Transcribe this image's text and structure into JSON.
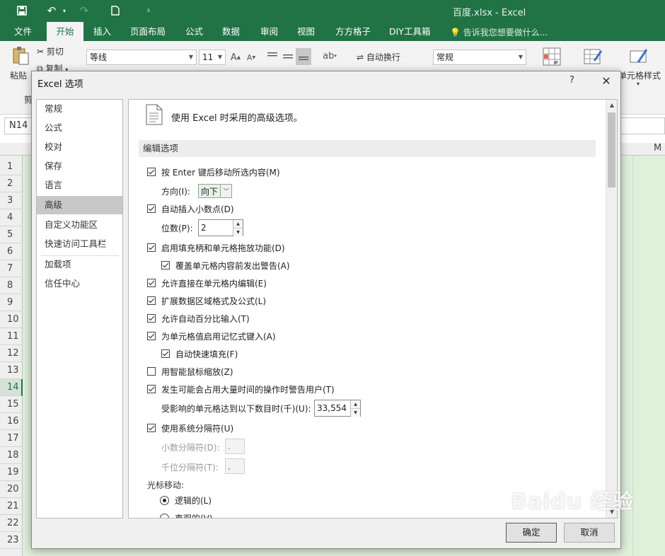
{
  "window": {
    "title": "百度.xlsx - Excel"
  },
  "ribbon_tabs": [
    "文件",
    "开始",
    "插入",
    "页面布局",
    "公式",
    "数据",
    "审阅",
    "视图",
    "方方格子",
    "DIY工具箱"
  ],
  "tell_me": "告诉我您想要做什么...",
  "ribbon": {
    "paste": "粘贴",
    "cut": "剪切",
    "copy": "复制",
    "clipboard_cut": "剪",
    "font_name": "等线",
    "font_size": "11",
    "wrap_text": "自动换行",
    "number_format": "常规",
    "cell_style": "单元格样式"
  },
  "name_box": "N14",
  "sheet": {
    "col_visible": "M",
    "rows": [
      "1",
      "2",
      "3",
      "4",
      "5",
      "6",
      "7",
      "8",
      "9",
      "10",
      "11",
      "12",
      "13",
      "14",
      "15",
      "16",
      "17",
      "18",
      "19",
      "20",
      "21",
      "22",
      "23"
    ],
    "selected_row": "14"
  },
  "dialog": {
    "title": "Excel 选项",
    "help": "?",
    "nav": [
      "常规",
      "公式",
      "校对",
      "保存",
      "语言",
      "高级",
      "自定义功能区",
      "快速访问工具栏",
      "加载项",
      "信任中心"
    ],
    "active_nav": "高级",
    "header": "使用 Excel 时采用的高级选项。",
    "section": "编辑选项",
    "options": {
      "move_after_enter": "按 Enter 键后移动所选内容(M)",
      "direction_label": "方向(I):",
      "direction_value": "向下",
      "auto_decimal": "自动插入小数点(D)",
      "places_label": "位数(P):",
      "places_value": "2",
      "fill_handle": "启用填充柄和单元格拖放功能(D)",
      "alert_overwrite": "覆盖单元格内容前发出警告(A)",
      "edit_in_cell": "允许直接在单元格内编辑(E)",
      "extend_formats": "扩展数据区域格式及公式(L)",
      "auto_percent": "允许自动百分比输入(T)",
      "autocomplete": "为单元格值启用记忆式键入(A)",
      "flash_fill": "自动快速填充(F)",
      "intellimouse": "用智能鼠标缩放(Z)",
      "alert_slow": "发生可能会占用大量时间的操作时警告用户(T)",
      "cells_affected_label": "受影响的单元格达到以下数目时(千)(U):",
      "cells_affected_value": "33,554",
      "system_separators": "使用系统分隔符(U)",
      "decimal_sep_label": "小数分隔符(D):",
      "decimal_sep_value": ".",
      "thousands_sep_label": "千位分隔符(T):",
      "thousands_sep_value": ",",
      "cursor_movement": "光标移动:",
      "logical": "逻辑的(L)",
      "visual": "直观的(V)"
    },
    "ok": "确定",
    "cancel": "取消"
  },
  "watermark": "Baidu 经验"
}
